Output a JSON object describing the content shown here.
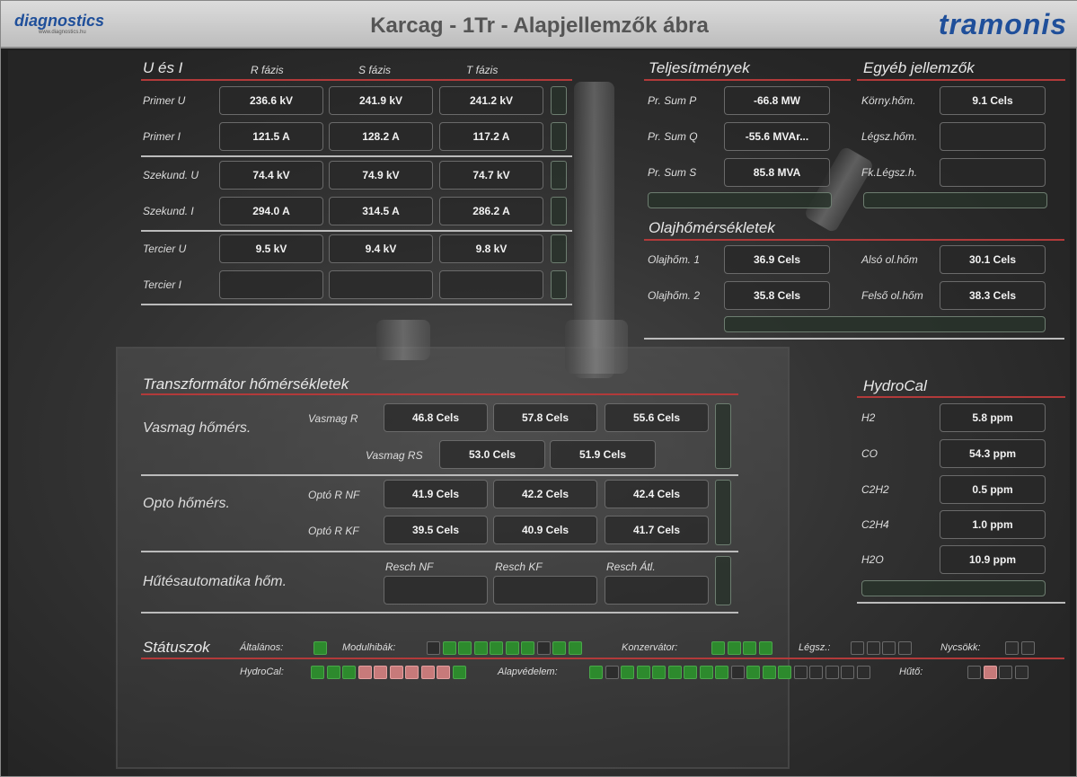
{
  "header": {
    "logo_left_main": "diagnostics",
    "logo_left_sub": "www.diagnostics.hu",
    "title": "Karcag - 1Tr - Alapjellemzők ábra",
    "logo_right": "tramonis"
  },
  "u_es_i": {
    "title": "U és I",
    "columns": [
      "R fázis",
      "S fázis",
      "T fázis"
    ],
    "rows": [
      {
        "label": "Primer U",
        "values": [
          "236.6 kV",
          "241.9 kV",
          "241.2 kV"
        ]
      },
      {
        "label": "Primer I",
        "values": [
          "121.5 A",
          "128.2 A",
          "117.2 A"
        ]
      },
      {
        "label": "Szekund. U",
        "values": [
          "74.4 kV",
          "74.9 kV",
          "74.7 kV"
        ]
      },
      {
        "label": "Szekund. I",
        "values": [
          "294.0 A",
          "314.5 A",
          "286.2 A"
        ]
      },
      {
        "label": "Tercier U",
        "values": [
          "9.5 kV",
          "9.4 kV",
          "9.8 kV"
        ]
      },
      {
        "label": "Tercier I",
        "values": [
          "",
          "",
          ""
        ]
      }
    ]
  },
  "teljesitmenyek": {
    "title": "Teljesítmények",
    "rows": [
      {
        "label": "Pr. Sum P",
        "value": "-66.8 MW"
      },
      {
        "label": "Pr. Sum Q",
        "value": "-55.6 MVAr..."
      },
      {
        "label": "Pr. Sum S",
        "value": "85.8 MVA"
      }
    ]
  },
  "egyeb": {
    "title": "Egyéb jellemzők",
    "rows": [
      {
        "label": "Körny.hőm.",
        "value": "9.1 Cels"
      },
      {
        "label": "Légsz.hőm.",
        "value": ""
      },
      {
        "label": "Fk.Légsz.h.",
        "value": ""
      }
    ]
  },
  "olaj": {
    "title": "Olajhőmérsékletek",
    "left": [
      {
        "label": "Olajhőm. 1",
        "value": "36.9 Cels"
      },
      {
        "label": "Olajhőm. 2",
        "value": "35.8 Cels"
      }
    ],
    "right": [
      {
        "label": "Alsó ol.hőm",
        "value": "30.1 Cels"
      },
      {
        "label": "Felső ol.hőm",
        "value": "38.3 Cels"
      }
    ]
  },
  "trafo": {
    "title": "Transzformátor hőmérsékletek",
    "vasmag_title": "Vasmag hőmérs.",
    "vasmag_r_label": "Vasmag R",
    "vasmag_r": [
      "46.8 Cels",
      "57.8 Cels",
      "55.6 Cels"
    ],
    "vasmag_rs_label": "Vasmag RS",
    "vasmag_rs": [
      "53.0 Cels",
      "51.9 Cels"
    ],
    "opto_title": "Opto hőmérs.",
    "opto_nf_label": "Optó R NF",
    "opto_nf": [
      "41.9 Cels",
      "42.2 Cels",
      "42.4 Cels"
    ],
    "opto_kf_label": "Optó R KF",
    "opto_kf": [
      "39.5 Cels",
      "40.9 Cels",
      "41.7 Cels"
    ],
    "hutes_title": "Hűtésautomatika hőm.",
    "resch_heads": [
      "Resch NF",
      "Resch KF",
      "Resch Átl."
    ],
    "resch_values": [
      "",
      "",
      ""
    ]
  },
  "hydrocal": {
    "title": "HydroCal",
    "rows": [
      {
        "label": "H2",
        "value": "5.8 ppm"
      },
      {
        "label": "CO",
        "value": "54.3 ppm"
      },
      {
        "label": "C2H2",
        "value": "0.5 ppm"
      },
      {
        "label": "C2H4",
        "value": "1.0 ppm"
      },
      {
        "label": "H2O",
        "value": "10.9 ppm"
      }
    ]
  },
  "status": {
    "title": "Státuszok",
    "altalanos_label": "Általános:",
    "modulhibak_label": "Modulhibák:",
    "konzervator_label": "Konzervátor:",
    "legsz_label": "Légsz.:",
    "nycsokk_label": "Nycsökk:",
    "hydrocal_label": "HydroCal:",
    "alapvedelem_label": "Alapvédelem:",
    "huto_label": "Hűtő:",
    "led_colors": {
      "green": "#2d8a2d",
      "red": "#c77a7a",
      "off": "#2d2d2d"
    },
    "altalanos": [
      "g"
    ],
    "modulhibak": [
      "o",
      "g",
      "g",
      "g",
      "g",
      "g",
      "g",
      "o",
      "g",
      "g"
    ],
    "konzervator": [
      "g",
      "g",
      "g",
      "g"
    ],
    "legsz": [
      "o",
      "o",
      "o",
      "o"
    ],
    "nycsokk": [
      "o",
      "o"
    ],
    "hydrocal": [
      "g",
      "g",
      "g",
      "r",
      "r",
      "r",
      "r",
      "r",
      "r",
      "g"
    ],
    "alapvedelem": [
      "g",
      "o",
      "g",
      "g",
      "g",
      "g",
      "g",
      "g",
      "g",
      "o",
      "g",
      "g",
      "g",
      "o",
      "o",
      "o",
      "o",
      "o"
    ],
    "huto": [
      "o",
      "r",
      "o",
      "o"
    ]
  }
}
